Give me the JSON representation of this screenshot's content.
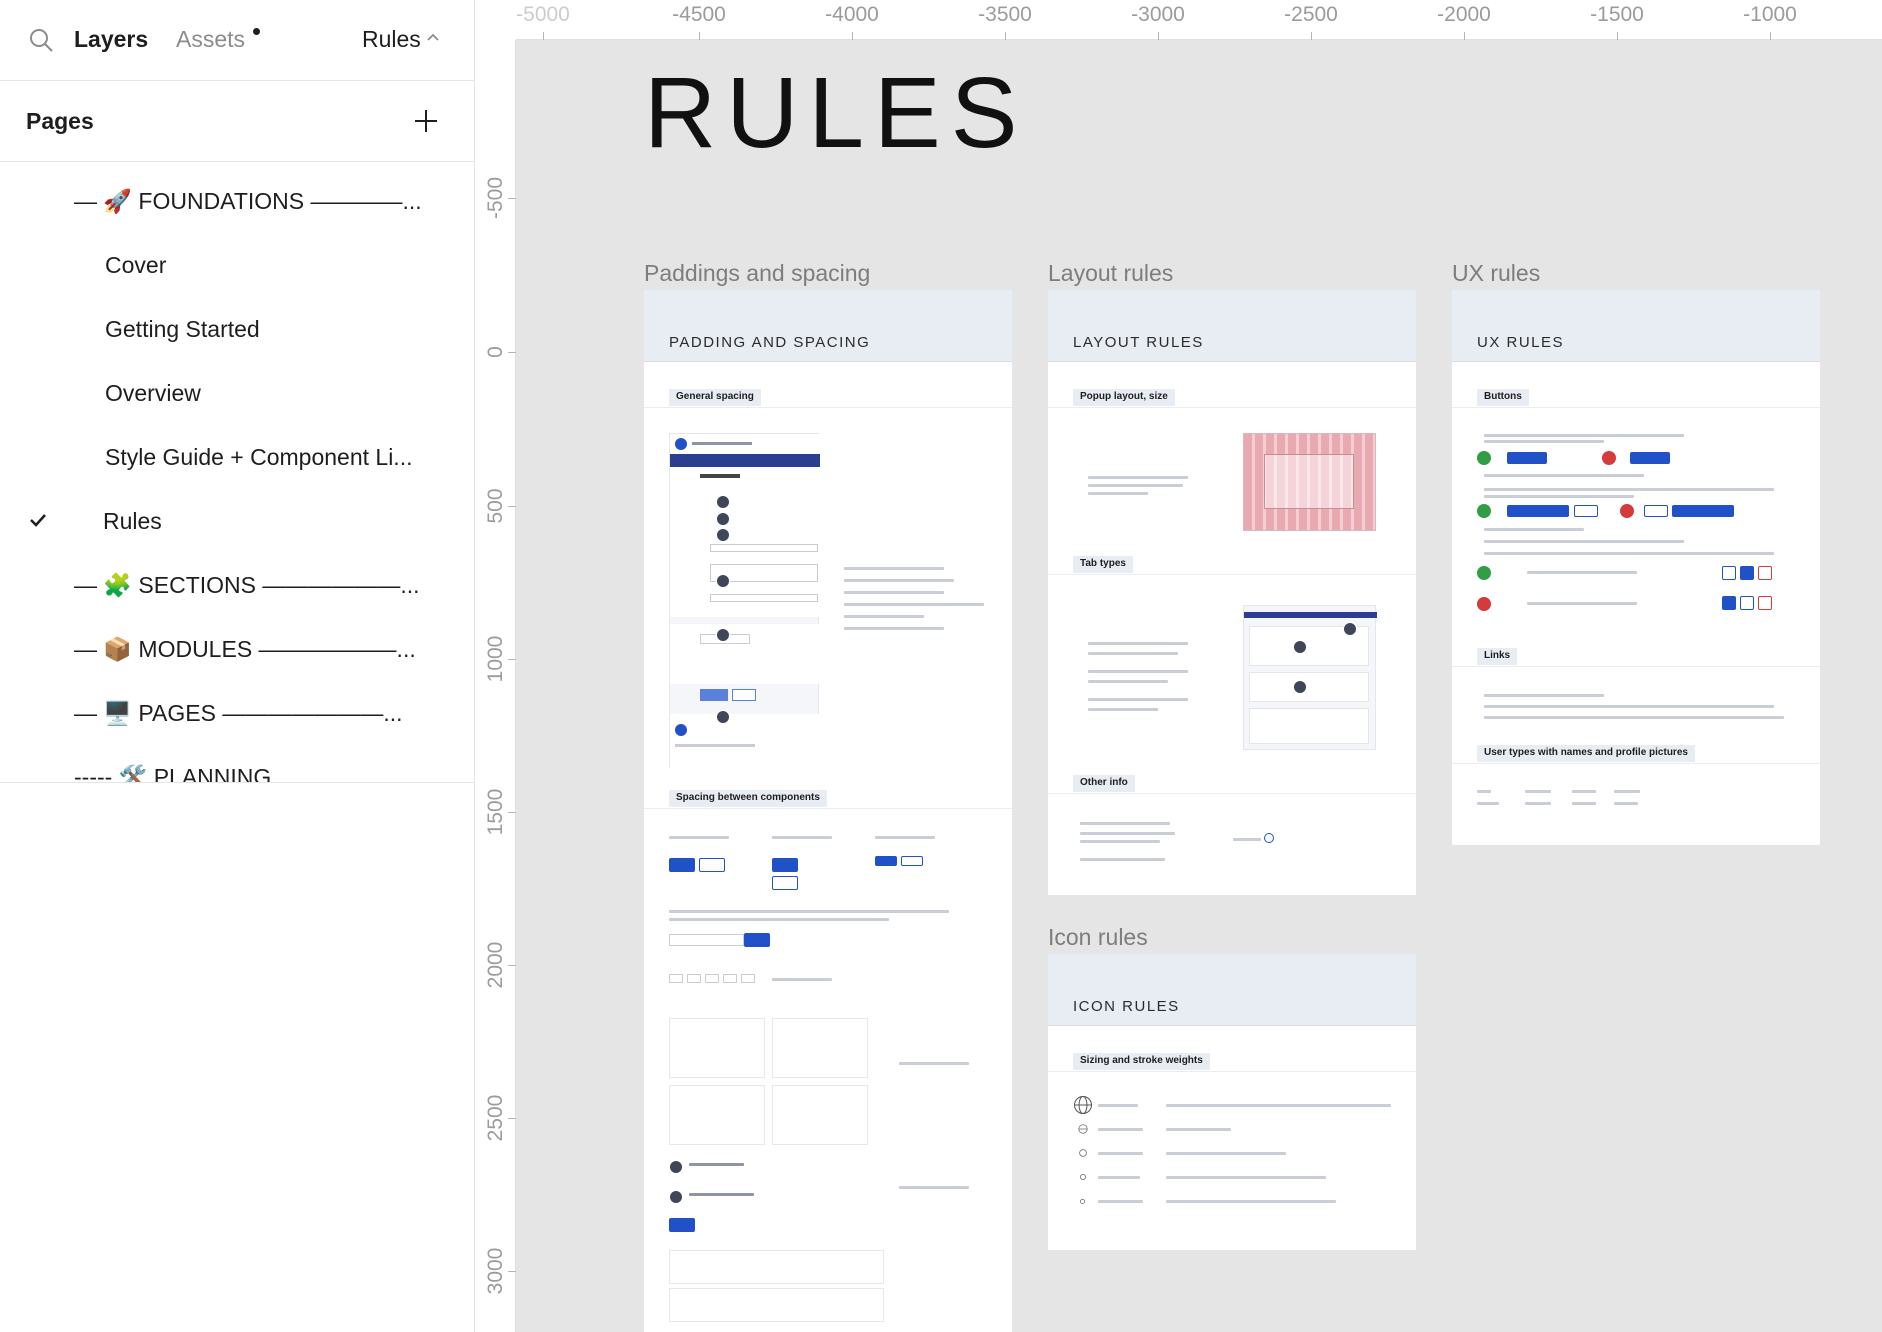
{
  "topbar": {
    "tab_layers": "Layers",
    "tab_assets": "Assets",
    "current_page": "Rules"
  },
  "pages": {
    "title": "Pages",
    "items": [
      {
        "label": "— 🚀 FOUNDATIONS ————..."
      },
      {
        "label": "Cover"
      },
      {
        "label": "Getting Started"
      },
      {
        "label": "Overview"
      },
      {
        "label": "Style Guide + Component Li..."
      },
      {
        "label": "Rules"
      },
      {
        "label": "— 🧩 SECTIONS ——————..."
      },
      {
        "label": "— 📦 MODULES ——————..."
      },
      {
        "label": "— 🖥️ PAGES ———————..."
      },
      {
        "label": "----- 🛠️ PLANNING"
      }
    ]
  },
  "ruler": {
    "top": [
      "-5000",
      "-4500",
      "-4000",
      "-3500",
      "-3000",
      "-2500",
      "-2000",
      "-1500",
      "-1000"
    ],
    "left": [
      "-500",
      "0",
      "500",
      "1000",
      "1500",
      "2000",
      "2500",
      "3000"
    ]
  },
  "canvas": {
    "title": "RULES",
    "frames": {
      "padding": {
        "label": "Paddings and spacing",
        "header": "PADDING AND SPACING",
        "chips": [
          "General spacing",
          "Spacing between components"
        ]
      },
      "layout": {
        "label": "Layout rules",
        "header": "LAYOUT RULES",
        "chips": [
          "Popup layout, size",
          "Tab types",
          "Other info"
        ]
      },
      "ux": {
        "label": "UX rules",
        "header": "UX RULES",
        "chips": [
          "Buttons",
          "Links",
          "User types with names and profile pictures"
        ]
      },
      "icon": {
        "label": "Icon rules",
        "header": "ICON RULES",
        "chips": [
          "Sizing and stroke weights"
        ]
      }
    }
  }
}
